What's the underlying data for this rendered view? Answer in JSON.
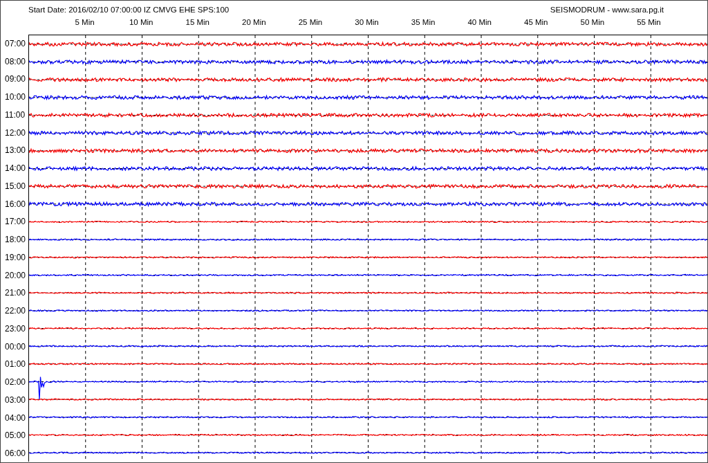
{
  "header": {
    "start_info": "Start Date: 2016/02/10 07:00:00 IZ CMVG EHE SPS:100",
    "brand": "SEISMODRUM - www.sara.pg.it"
  },
  "minute_labels": [
    "5 Min",
    "10 Min",
    "15 Min",
    "20 Min",
    "25 Min",
    "30 Min",
    "35 Min",
    "40 Min",
    "45 Min",
    "50 Min",
    "55 Min"
  ],
  "traces": [
    {
      "hour": "07:00",
      "color": "#ff0000"
    },
    {
      "hour": "08:00",
      "color": "#0000ff"
    },
    {
      "hour": "09:00",
      "color": "#ff0000"
    },
    {
      "hour": "10:00",
      "color": "#0000ff"
    },
    {
      "hour": "11:00",
      "color": "#ff0000"
    },
    {
      "hour": "12:00",
      "color": "#0000ff"
    },
    {
      "hour": "13:00",
      "color": "#ff0000"
    },
    {
      "hour": "14:00",
      "color": "#0000ff"
    },
    {
      "hour": "15:00",
      "color": "#ff0000"
    },
    {
      "hour": "16:00",
      "color": "#0000ff"
    },
    {
      "hour": "17:00",
      "color": "#ff0000"
    },
    {
      "hour": "18:00",
      "color": "#0000ff"
    },
    {
      "hour": "19:00",
      "color": "#ff0000"
    },
    {
      "hour": "20:00",
      "color": "#0000ff"
    },
    {
      "hour": "21:00",
      "color": "#ff0000"
    },
    {
      "hour": "22:00",
      "color": "#0000ff"
    },
    {
      "hour": "23:00",
      "color": "#ff0000"
    },
    {
      "hour": "00:00",
      "color": "#0000ff"
    },
    {
      "hour": "01:00",
      "color": "#ff0000"
    },
    {
      "hour": "02:00",
      "color": "#0000ff"
    },
    {
      "hour": "03:00",
      "color": "#ff0000"
    },
    {
      "hour": "04:00",
      "color": "#0000ff"
    },
    {
      "hour": "05:00",
      "color": "#ff0000"
    },
    {
      "hour": "06:00",
      "color": "#0000ff"
    }
  ]
}
